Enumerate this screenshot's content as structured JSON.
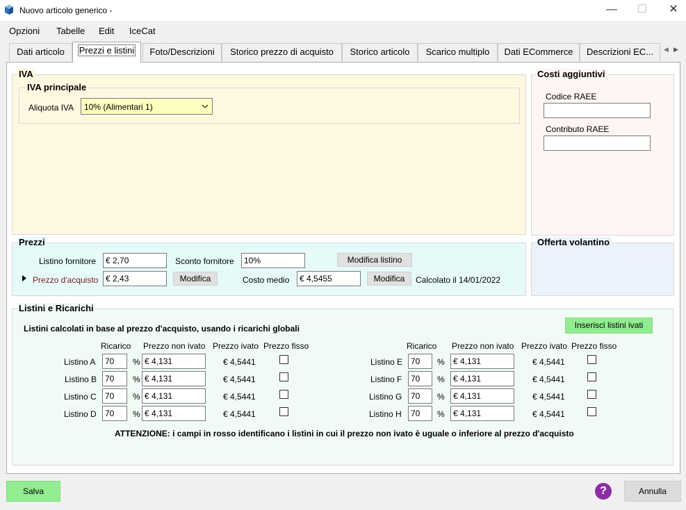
{
  "window": {
    "title": "Nuovo articolo generico -",
    "minimize": "—",
    "maximize": "☐",
    "close": "✕"
  },
  "menu": [
    "Opzioni",
    "Tabelle",
    "Edit",
    "IceCat"
  ],
  "tabs": [
    "Dati articolo",
    "Prezzi e listini",
    "Foto/Descrizioni",
    "Storico prezzo di acquisto",
    "Storico articolo",
    "Scarico multiplo",
    "Dati ECommerce",
    "Descrizioni  EC..."
  ],
  "tab_scroll": {
    "left": "◀",
    "right": "▶"
  },
  "iva": {
    "group": "IVA",
    "sub": "IVA principale",
    "aliquota_label": "Aliquota IVA",
    "aliquota_value": "10% (Alimentari 1)"
  },
  "costi": {
    "group": "Costi aggiuntivi",
    "codice_label": "Codice RAEE",
    "contributo_label": "Contributo RAEE",
    "codice_value": "",
    "contributo_value": ""
  },
  "prezzi": {
    "group": "Prezzi",
    "listino_fornitore_label": "Listino fornitore",
    "listino_fornitore_value": "€ 2,70",
    "sconto_label": "Sconto fornitore",
    "sconto_value": "10%",
    "modifica_listino": "Modifica listino",
    "prezzo_acquisto_label": "Prezzo d'acquisto",
    "prezzo_acquisto_value": "€ 2,43",
    "modifica": "Modifica",
    "costo_medio_label": "Costo medio",
    "costo_medio_value": "€ 4,5455",
    "modifica2": "Modifica",
    "calcolato": "Calcolato il  14/01/2022"
  },
  "offerta": {
    "group": "Offerta volantino"
  },
  "listini": {
    "group": "Listini e Ricarichi",
    "subtitle": "Listini calcolati in base al prezzo d'acquisto, usando i ricarichi globali",
    "inserisci": "Inserisci listini ivati",
    "headers": {
      "ricarico": "Ricarico",
      "non_ivato": "Prezzo non ivato",
      "ivato": "Prezzo ivato",
      "fisso": "Prezzo fisso"
    },
    "percent": "%",
    "left": [
      {
        "name": "Listino A",
        "ricarico": "70",
        "non_ivato": "€ 4,131",
        "ivato": "€ 4,5441"
      },
      {
        "name": "Listino B",
        "ricarico": "70",
        "non_ivato": "€ 4,131",
        "ivato": "€ 4,5441"
      },
      {
        "name": "Listino C",
        "ricarico": "70",
        "non_ivato": "€ 4,131",
        "ivato": "€ 4,5441"
      },
      {
        "name": "Listino D",
        "ricarico": "70",
        "non_ivato": "€ 4,131",
        "ivato": "€ 4,5441"
      }
    ],
    "right": [
      {
        "name": "Listino E",
        "ricarico": "70",
        "non_ivato": "€ 4,131",
        "ivato": "€ 4,5441"
      },
      {
        "name": "Listino F",
        "ricarico": "70",
        "non_ivato": "€ 4,131",
        "ivato": "€ 4,5441"
      },
      {
        "name": "Listino G",
        "ricarico": "70",
        "non_ivato": "€ 4,131",
        "ivato": "€ 4,5441"
      },
      {
        "name": "Listino H",
        "ricarico": "70",
        "non_ivato": "€ 4,131",
        "ivato": "€ 4,5441"
      }
    ],
    "attenzione": "ATTENZIONE: i campi in rosso identificano i listini in cui il prezzo non ivato è uguale o inferiore al prezzo d'acquisto"
  },
  "footer": {
    "salva": "Salva",
    "help": "?",
    "annulla": "Annulla"
  },
  "colors": {
    "iva_bg": "#fff8e1",
    "costi_bg": "#fdf6f4",
    "prezzi_bg": "#e6fafa",
    "offerta_bg": "#eaf2fb",
    "listini_bg": "#f1fbf5",
    "select_bg": "#ffffc0",
    "green_btn": "#90ee90",
    "help": "#8e2ea4"
  }
}
